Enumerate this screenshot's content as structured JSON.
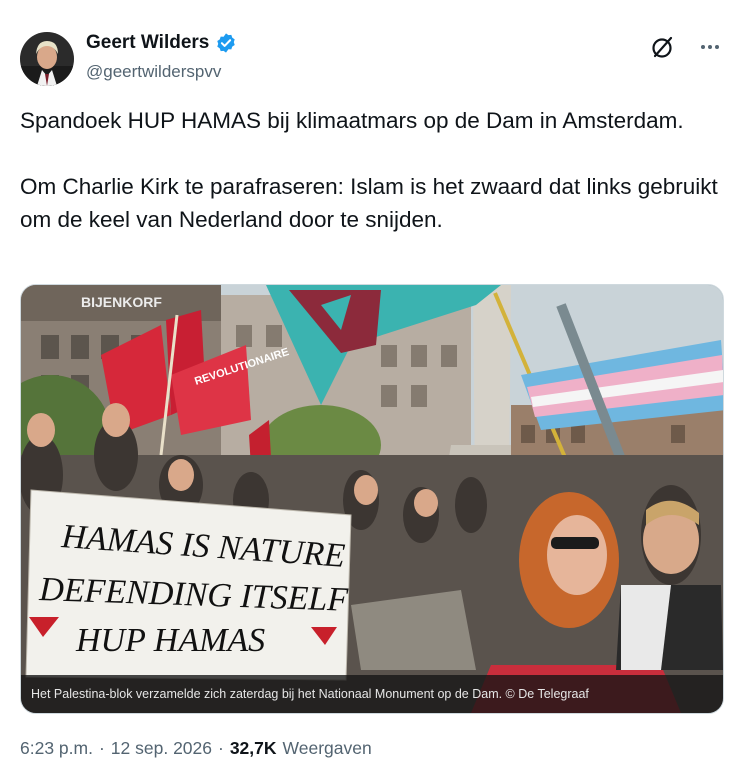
{
  "author": {
    "name": "Geert Wilders",
    "handle": "@geertwilderspvv",
    "verified": true,
    "avatar_icon": "profile-photo"
  },
  "actions": {
    "grok_icon": "grok-slash-icon",
    "more_icon": "more-horizontal-icon"
  },
  "tweet": {
    "paragraphs": [
      "Spandoek HUP HAMAS bij klimaatmars op de Dam in Amsterdam.",
      "Om Charlie Kirk te parafraseren: Islam is het zwaard dat links gebruikt om de keel van Nederland door te snijden."
    ]
  },
  "media": {
    "banner_lines": [
      "HAMAS IS NATURE",
      "DEFENDING ITSELF",
      "HUP HAMAS"
    ],
    "building_sign": "BIJENKORF",
    "protest_sign_text": "REVOLUTIONAIRE",
    "caption": "Het Palestina-blok verzamelde zich zaterdag bij het Nationaal Monument op de Dam. © De Telegraaf"
  },
  "meta": {
    "time": "6:23 p.m.",
    "separator": "·",
    "date": "12 sep. 2026",
    "views_count": "32,7K",
    "views_label": "Weergaven"
  },
  "colors": {
    "text": "#0f1419",
    "secondary": "#536471",
    "verified_blue": "#1d9bf0",
    "border": "#cfd9de"
  }
}
